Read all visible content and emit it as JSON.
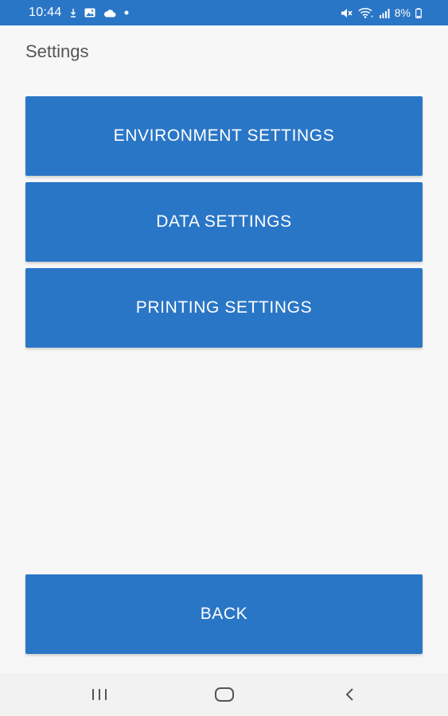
{
  "status_bar": {
    "time": "10:44",
    "battery": "8%",
    "left_icons": [
      "download-icon",
      "image-icon",
      "cloud-icon",
      "dot-icon"
    ],
    "right_icons": [
      "mute-icon",
      "wifi-icon",
      "signal-icon",
      "battery-icon"
    ]
  },
  "page": {
    "title": "Settings"
  },
  "menu": {
    "environment_label": "ENVIRONMENT SETTINGS",
    "data_label": "DATA SETTINGS",
    "printing_label": "PRINTING SETTINGS"
  },
  "footer": {
    "back_label": "BACK"
  },
  "navigation": {
    "icons": [
      "recents-icon",
      "home-icon",
      "back-nav-icon"
    ]
  },
  "colors": {
    "accent": "#2a76c6",
    "background": "#f7f7f7",
    "title_text": "#555555"
  }
}
